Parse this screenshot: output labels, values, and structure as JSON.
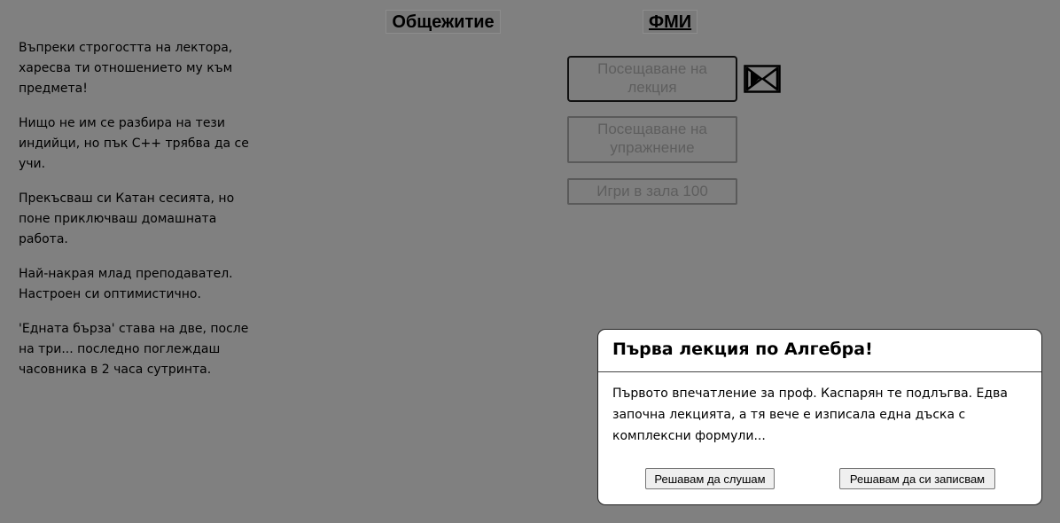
{
  "nav": {
    "tab_dorm": "Общежитие",
    "tab_fmi": "ФМИ"
  },
  "log": [
    "Въпреки строгостта на лектора, харесва ти отношението му към предмета!",
    "Нищо не им се разбира на тези индийци, но пък C++ трябва да се учи.",
    "Прекъсваш си Катан сесията, но поне приключваш домашната работа.",
    "Най-накрая млад преподавател. Настроен си оптимистично.",
    "'Едната бърза' става на две, после на три... последно поглеждаш часовника в 2 часа сутринта."
  ],
  "actions": {
    "lecture": "Посещаване на лекция",
    "exercise": "Посещаване на упражнение",
    "hall": "Игри в зала 100"
  },
  "icons": {
    "busy": "hourglass-icon"
  },
  "modal": {
    "title": "Първа лекция по Алгебра!",
    "body": "Първото впечатление за проф. Каспарян те подлъгва. Едва започна лекцията, а тя вече е изписала една дъска с комплексни формули...",
    "btn_listen": "Решавам да слушам",
    "btn_notes": "Решавам да си записвам"
  },
  "colors": {
    "overlay_background": "#808080",
    "modal_background": "#ffffff"
  }
}
